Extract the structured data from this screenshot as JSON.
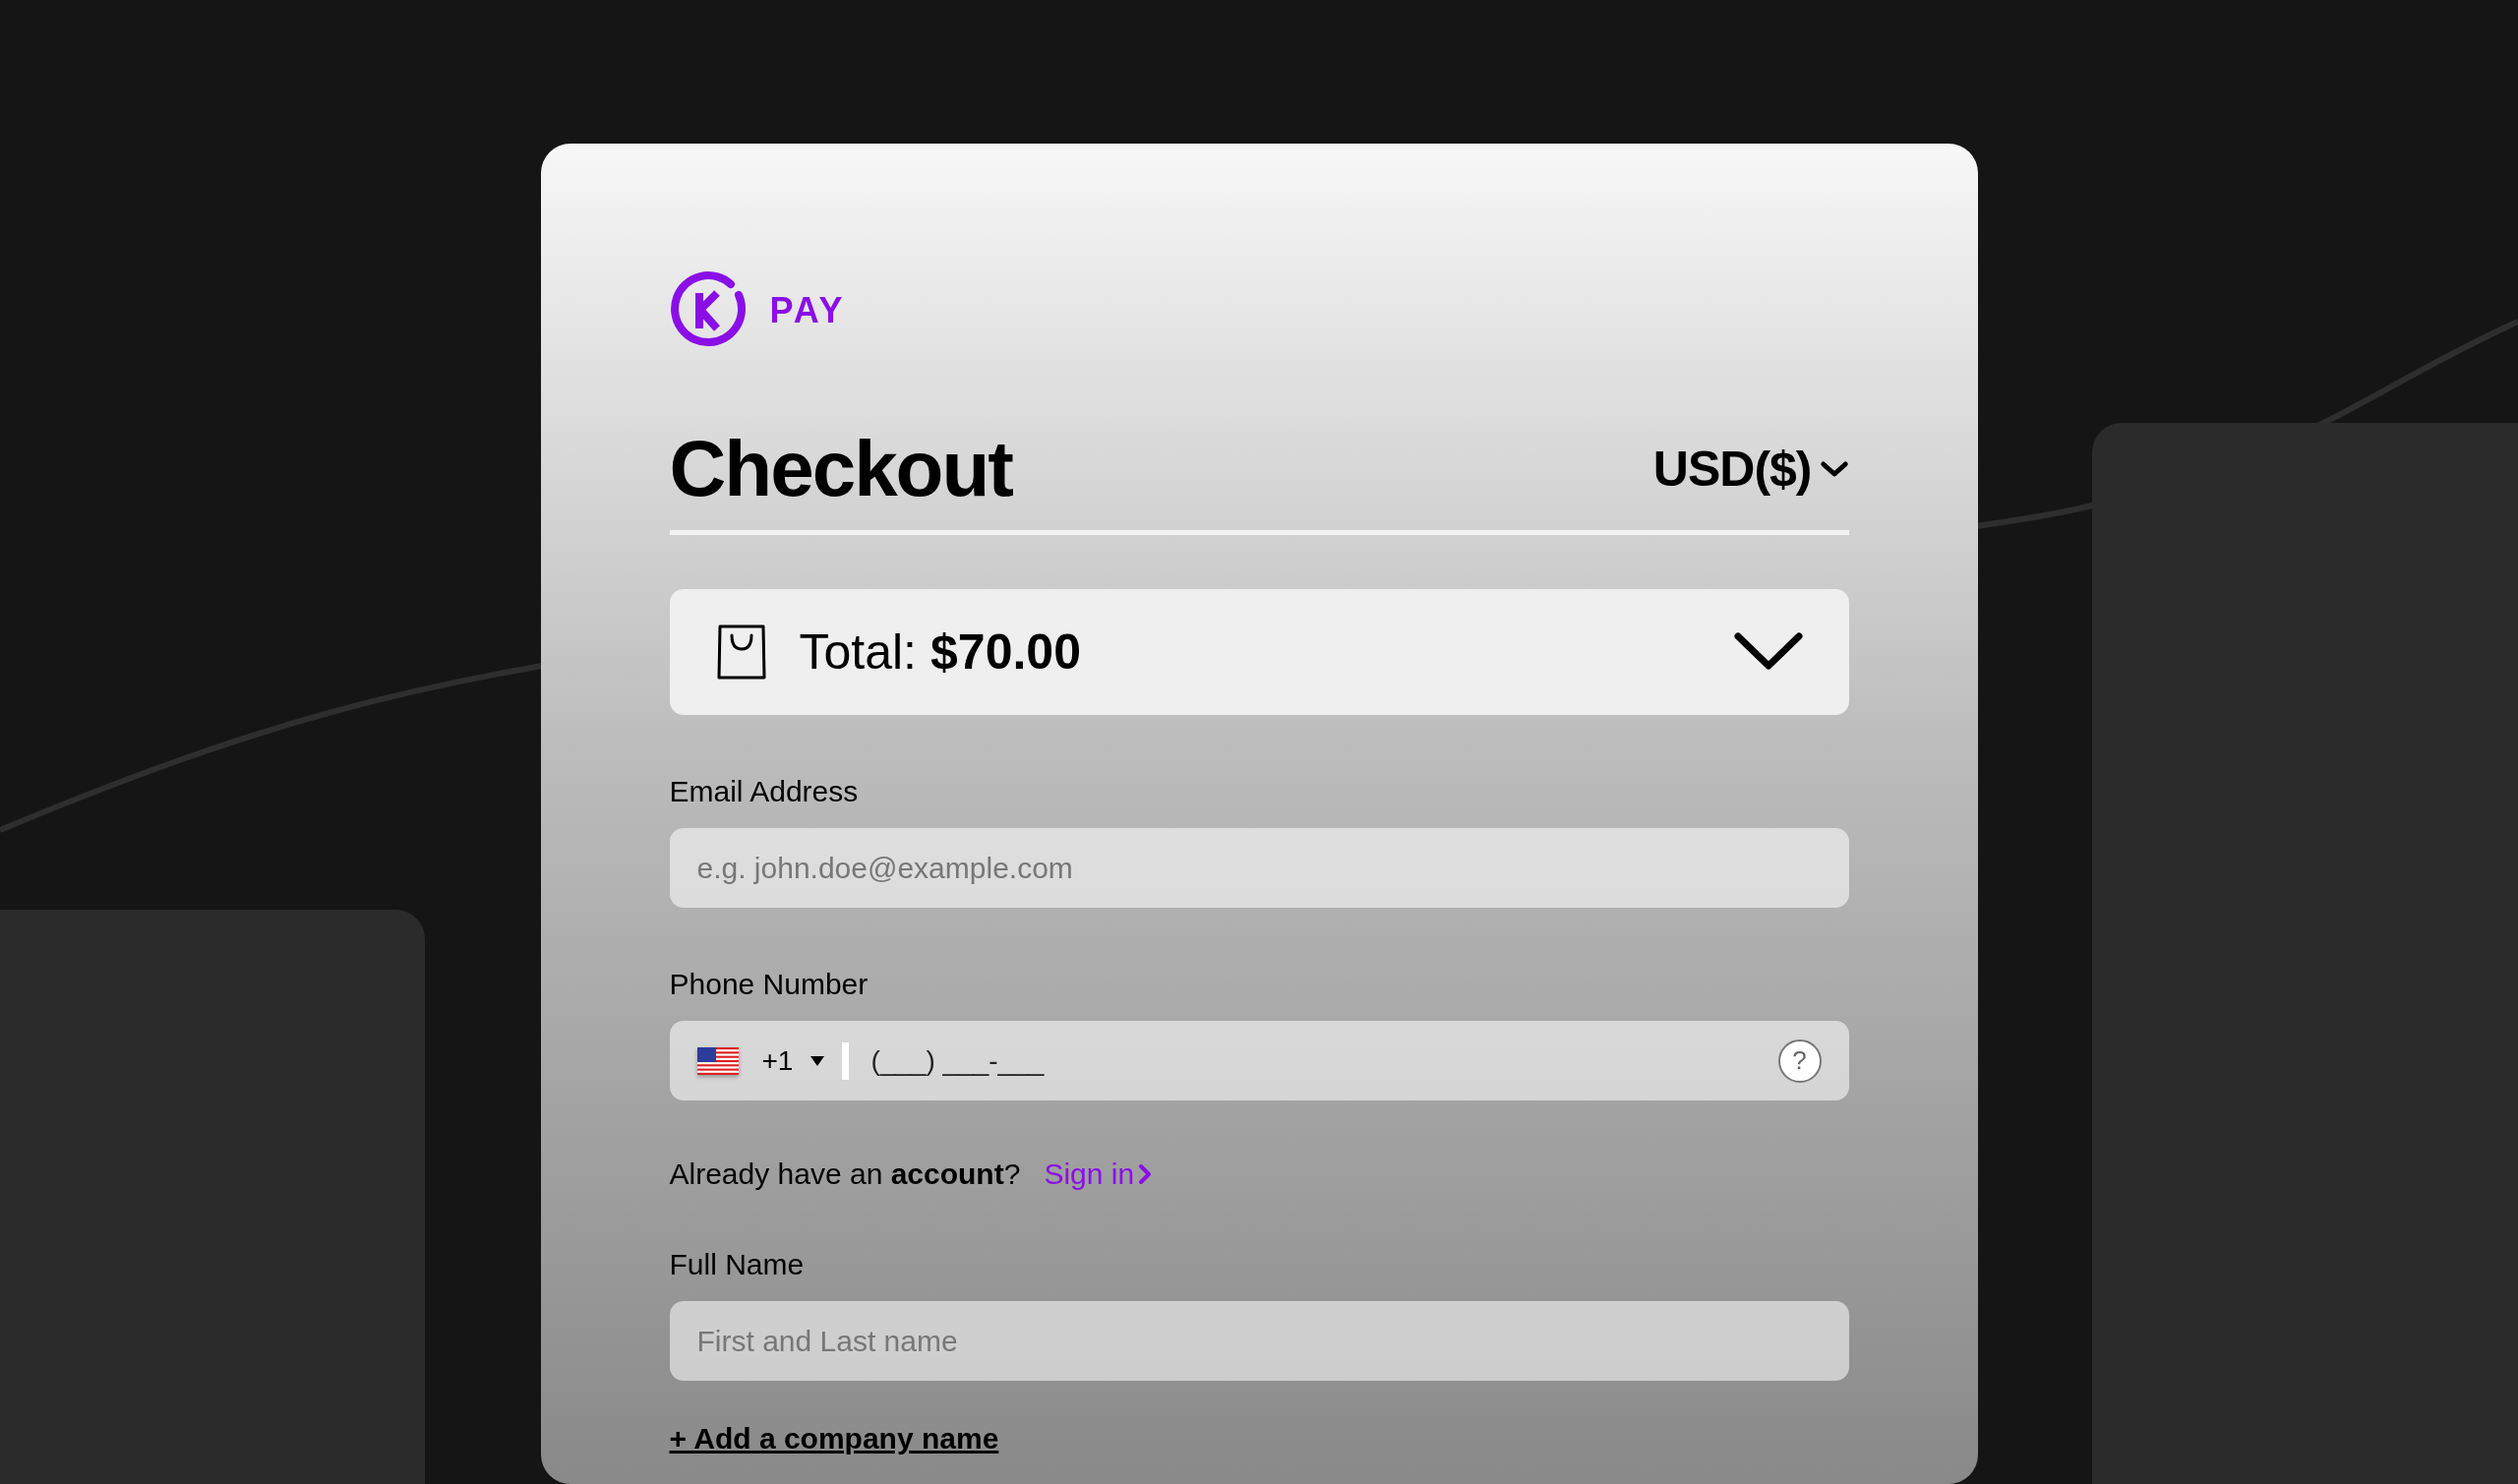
{
  "brand": {
    "name": "PAY"
  },
  "header": {
    "title": "Checkout",
    "currency": "USD($)"
  },
  "order_summary": {
    "label": "Total:",
    "amount": "$70.00",
    "expanded": false
  },
  "form": [
    {
      "kind": "text",
      "label": "Email Address",
      "placeholder": "e.g. john.doe@example.com"
    },
    {
      "kind": "phone",
      "label": "Phone Number",
      "country_code": "+1",
      "placeholder": "(___) ___-___",
      "help": "?"
    },
    {
      "kind": "signin",
      "prompt": "Already have an **account**?",
      "link": "Sign in"
    },
    {
      "kind": "text",
      "label": "Full Name",
      "placeholder": "First and Last name"
    },
    {
      "kind": "link",
      "text": "+ Add a company name"
    }
  ]
}
